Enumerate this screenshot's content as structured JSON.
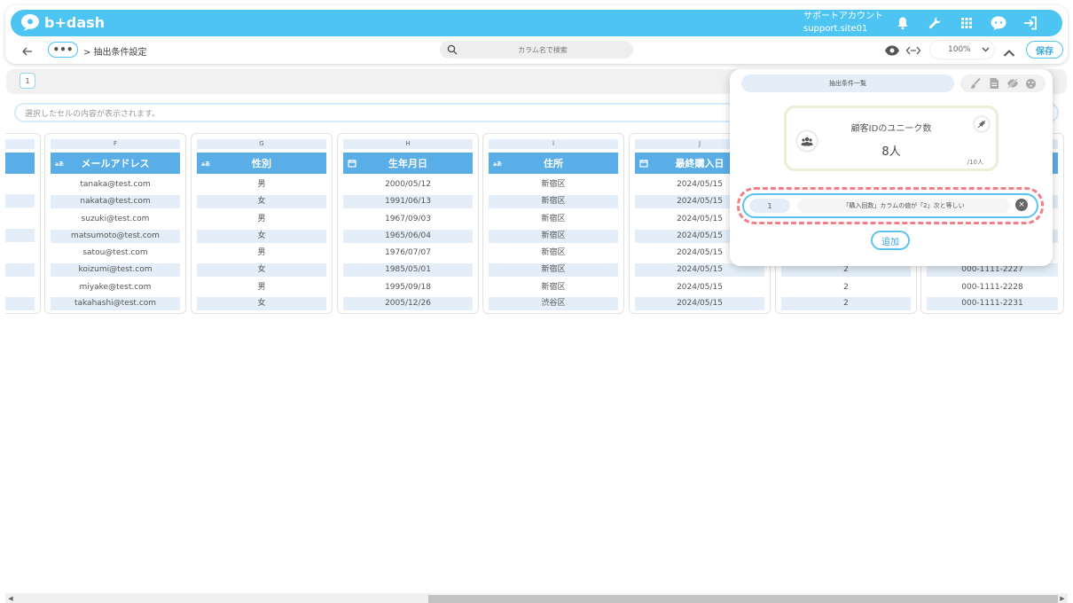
{
  "header": {
    "logo_text": "b+dash",
    "account_line1": "サポートアカウント",
    "account_line2": "support.site01",
    "brand_color": "#4ec4f2"
  },
  "nav": {
    "back_icon": "arrow-left-icon",
    "more_label": "•••",
    "breadcrumb": "> 抽出条件設定",
    "search_placeholder": "カラム名で検索",
    "zoom": "100%",
    "save_label": "保存"
  },
  "pages": {
    "current": "1"
  },
  "cellbar": {
    "placeholder": "選択したセルの内容が表示されます。"
  },
  "columns": [
    {
      "letter": "F",
      "header": "メールアドレス",
      "type": "text",
      "cells": [
        "tanaka@test.com",
        "nakata@test.com",
        "suzuki@test.com",
        "matsumoto@test.com",
        "satou@test.com",
        "koizumi@test.com",
        "miyake@test.com",
        "takahashi@test.com"
      ]
    },
    {
      "letter": "G",
      "header": "性別",
      "type": "text",
      "cells": [
        "男",
        "女",
        "男",
        "女",
        "男",
        "女",
        "男",
        "女"
      ]
    },
    {
      "letter": "H",
      "header": "生年月日",
      "type": "date",
      "cells": [
        "2000/05/12",
        "1991/06/13",
        "1967/09/03",
        "1965/06/04",
        "1976/07/07",
        "1985/05/01",
        "1995/09/18",
        "2005/12/26"
      ]
    },
    {
      "letter": "I",
      "header": "住所",
      "type": "text",
      "cells": [
        "新宿区",
        "新宿区",
        "新宿区",
        "新宿区",
        "新宿区",
        "新宿区",
        "新宿区",
        "渋谷区"
      ]
    },
    {
      "letter": "J",
      "header": "最終購入日",
      "type": "date",
      "cells": [
        "2024/05/15",
        "2024/05/15",
        "2024/05/15",
        "2024/05/15",
        "2024/05/15",
        "2024/05/15",
        "2024/05/15",
        "2024/05/15"
      ]
    },
    {
      "letter": "",
      "header": "",
      "type": "number",
      "cells": [
        "",
        "",
        "",
        "",
        "",
        "2",
        "2",
        "2"
      ]
    },
    {
      "letter": "",
      "header": "",
      "type": "text",
      "cells": [
        "",
        "",
        "",
        "",
        "",
        "000-1111-2227",
        "000-1111-2228",
        "000-1111-2231"
      ]
    }
  ],
  "popover": {
    "tab_label": "抽出条件一覧",
    "count_title": "顧客IDのユニーク数",
    "count_value": "8人",
    "count_total": "/10人",
    "condition_number": "1",
    "condition_text": "「購入回数」カラムの値が「2」次と等しい",
    "add_label": "追加",
    "highlight_color": "#f07f8a"
  }
}
